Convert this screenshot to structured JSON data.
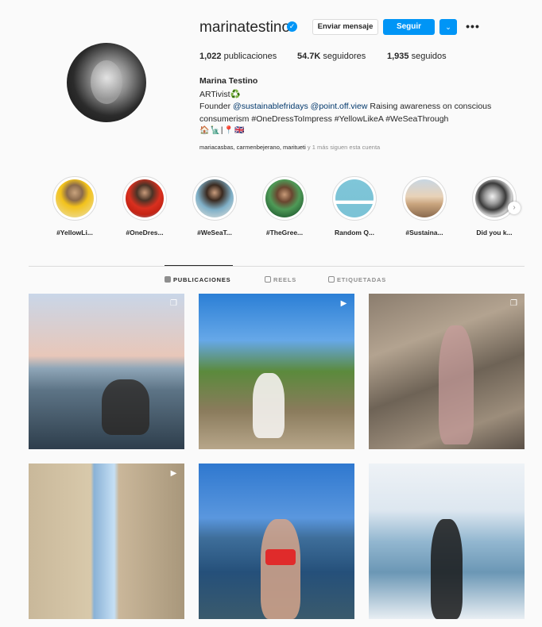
{
  "profile": {
    "username": "marinatestino",
    "verified_mark": "✓",
    "message_button": "Enviar mensaje",
    "follow_button": "Seguir",
    "dropdown_icon": "⌄",
    "more_icon": "•••",
    "stats": {
      "posts_count": "1,022",
      "posts_label": "publicaciones",
      "followers_count": "54.7K",
      "followers_label": "seguidores",
      "following_count": "1,935",
      "following_label": "seguidos"
    },
    "full_name": "Marina Testino",
    "bio": {
      "line1": "ARTivist♻️",
      "line2_prefix": "Founder ",
      "mention1": "@sustainablefridays",
      "mention2": "@point.off.view",
      "line2_suffix": " Raising awareness on conscious",
      "line3": "consumerism #OneDressToImpress #YellowLikeA #WeSeaThrough",
      "line4": "🏠🗽|📍🇬🇧"
    },
    "followed_by_names": "mariacasbas, carmenbejerano, maritueti",
    "followed_by_suffix": " y 1 más siguen esta cuenta"
  },
  "highlights": [
    {
      "label": "#YellowLi..."
    },
    {
      "label": "#OneDres..."
    },
    {
      "label": "#WeSeaT..."
    },
    {
      "label": "#TheGree..."
    },
    {
      "label": "Random Q..."
    },
    {
      "label": "#Sustaina..."
    },
    {
      "label": "Did you k..."
    }
  ],
  "highlights_next_icon": "›",
  "tabs": [
    {
      "label": "PUBLICACIONES",
      "active": true
    },
    {
      "label": "REELS",
      "active": false
    },
    {
      "label": "ETIQUETADAS",
      "active": false
    }
  ],
  "posts": [
    {
      "type": "carousel",
      "badge_icon": "❐"
    },
    {
      "type": "reel",
      "badge_icon": "▶"
    },
    {
      "type": "carousel",
      "badge_icon": "❐"
    },
    {
      "type": "reel",
      "badge_icon": "▶"
    },
    {
      "type": "photo",
      "badge_icon": ""
    },
    {
      "type": "photo",
      "badge_icon": ""
    }
  ],
  "colors": {
    "accent": "#0095f6",
    "text": "#262626",
    "muted": "#8e8e8e",
    "mention": "#00376b",
    "border": "#dbdbdb"
  }
}
